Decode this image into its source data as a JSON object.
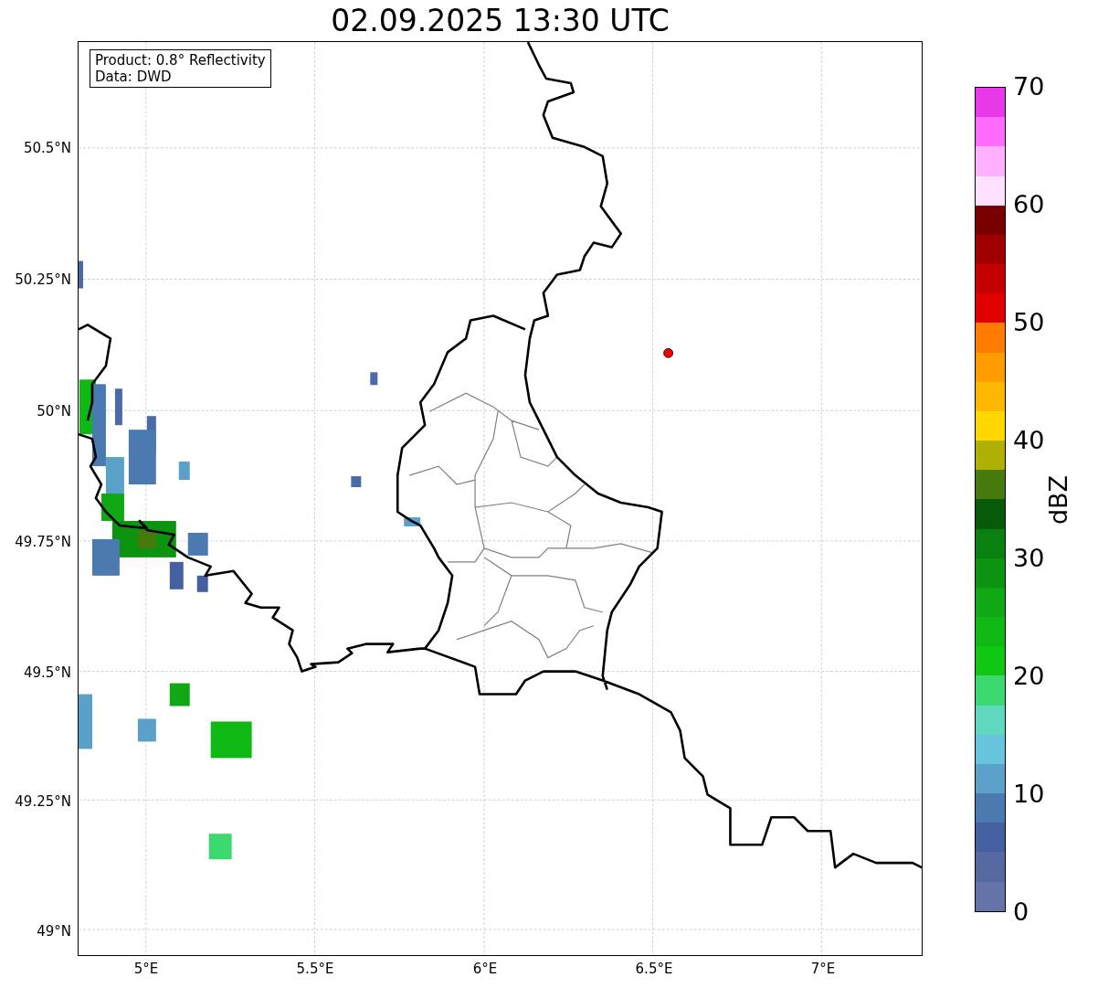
{
  "title": "02.09.2025 13:30 UTC",
  "info_box": {
    "lines": [
      "Product: 0.8° Reflectivity",
      "Data: DWD"
    ]
  },
  "map": {
    "x_ticks": [
      "5°E",
      "5.5°E",
      "6°E",
      "6.5°E",
      "7°E"
    ],
    "y_ticks": [
      "50.5°N",
      "50.25°N",
      "50°N",
      "49.75°N",
      "49.5°N",
      "49.25°N",
      "49°N"
    ]
  },
  "colorbar": {
    "label": "dBZ",
    "ticks": [
      "70",
      "60",
      "50",
      "40",
      "30",
      "20",
      "10",
      "0"
    ],
    "bands": [
      {
        "color": "#e838e8"
      },
      {
        "color": "#ff6cff"
      },
      {
        "color": "#ffb0ff"
      },
      {
        "color": "#ffe0ff"
      },
      {
        "color": "#780000"
      },
      {
        "color": "#a00000"
      },
      {
        "color": "#c40000"
      },
      {
        "color": "#e00000"
      },
      {
        "color": "#ff7c00"
      },
      {
        "color": "#ff9c00"
      },
      {
        "color": "#ffb800"
      },
      {
        "color": "#ffd800"
      },
      {
        "color": "#b0b004"
      },
      {
        "color": "#467a0c"
      },
      {
        "color": "#065a0a"
      },
      {
        "color": "#0a8010"
      },
      {
        "color": "#0c9410"
      },
      {
        "color": "#10a814"
      },
      {
        "color": "#10b814"
      },
      {
        "color": "#10c814"
      },
      {
        "color": "#3cd870"
      },
      {
        "color": "#60d8c0"
      },
      {
        "color": "#66c4dc"
      },
      {
        "color": "#5aa0c8"
      },
      {
        "color": "#4a7ab0"
      },
      {
        "color": "#4460a0"
      },
      {
        "color": "#5568a0"
      },
      {
        "color": "#6473a8"
      }
    ]
  }
}
